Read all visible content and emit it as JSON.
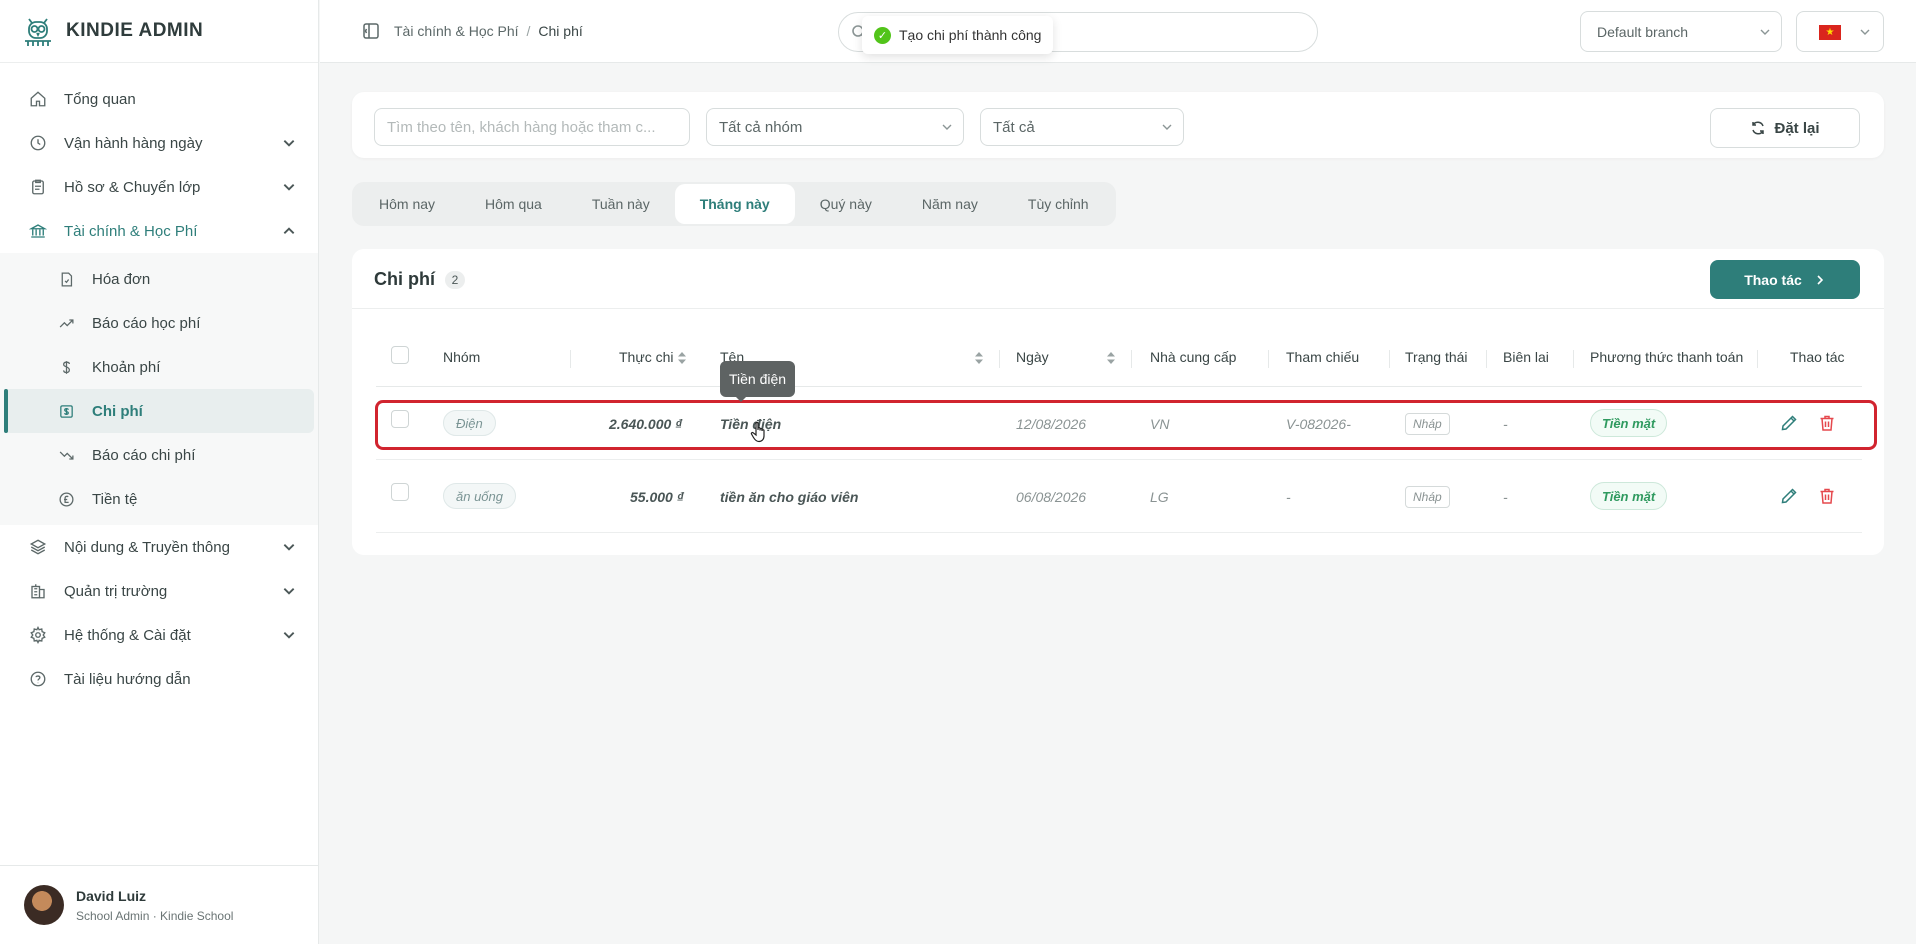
{
  "app": {
    "brand": "KINDIE ADMIN"
  },
  "sidebar": {
    "items": [
      {
        "label": "Tổng quan",
        "icon": "home-icon"
      },
      {
        "label": "Vận hành hàng ngày",
        "icon": "clock-icon"
      },
      {
        "label": "Hồ sơ & Chuyển lớp",
        "icon": "clipboard-icon"
      },
      {
        "label": "Tài chính & Học Phí",
        "icon": "bank-icon"
      },
      {
        "label": "Nội dung & Truyền thông",
        "icon": "layers-icon"
      },
      {
        "label": "Quản trị trường",
        "icon": "building-icon"
      },
      {
        "label": "Hệ thống & Cài đặt",
        "icon": "gear-icon"
      },
      {
        "label": "Tài liệu hướng dẫn",
        "icon": "help-icon"
      }
    ],
    "finance_sub": [
      {
        "label": "Hóa đơn",
        "icon": "invoice-icon"
      },
      {
        "label": "Báo cáo học phí",
        "icon": "trend-up-icon"
      },
      {
        "label": "Khoản phí",
        "icon": "dollar-icon"
      },
      {
        "label": "Chi phí",
        "icon": "expense-icon"
      },
      {
        "label": "Báo cáo chi phí",
        "icon": "trend-down-icon"
      },
      {
        "label": "Tiền tệ",
        "icon": "currency-icon"
      }
    ]
  },
  "user": {
    "name": "David Luiz",
    "role": "School Admin · Kindie School"
  },
  "topbar": {
    "breadcrumb": [
      "Tài chính & Học Phí",
      "/",
      "Chi phí"
    ],
    "branch": "Default branch"
  },
  "toast": {
    "message": "Tạo chi phí thành công"
  },
  "filters": {
    "search_placeholder": "Tìm theo tên, khách hàng hoặc tham c...",
    "group_select": "Tất cả nhóm",
    "status_select": "Tất cả",
    "reset_label": "Đặt lại"
  },
  "tabs": [
    "Hôm nay",
    "Hôm qua",
    "Tuần này",
    "Tháng này",
    "Quý này",
    "Năm nay",
    "Tùy chỉnh"
  ],
  "active_tab": "Tháng này",
  "card": {
    "title": "Chi phí",
    "count": "2",
    "actions_label": "Thao tác"
  },
  "table": {
    "columns": [
      "Nhóm",
      "Thực chi",
      "Tên",
      "Ngày",
      "Nhà cung cấp",
      "Tham chiếu",
      "Trạng thái",
      "Biên lai",
      "Phương thức thanh toán",
      "Thao tác"
    ],
    "rows": [
      {
        "group": "Điện",
        "amount": "2.640.000 ₫",
        "name": "Tiền điện",
        "date": "12/08/2026",
        "vendor": "VN",
        "reference": "V-082026-",
        "status": "Nháp",
        "receipt": "-",
        "method": "Tiền mặt"
      },
      {
        "group": "ăn uống",
        "amount": "55.000 ₫",
        "name": "tiền ăn cho giáo viên",
        "date": "06/08/2026",
        "vendor": "LG",
        "reference": "-",
        "status": "Nháp",
        "receipt": "-",
        "method": "Tiền mặt"
      }
    ]
  },
  "tooltip": {
    "text": "Tiền điện"
  },
  "colors": {
    "accent": "#2e7e7a",
    "highlight": "#d1242f",
    "success": "#52c41a",
    "delete": "#e5484d"
  }
}
